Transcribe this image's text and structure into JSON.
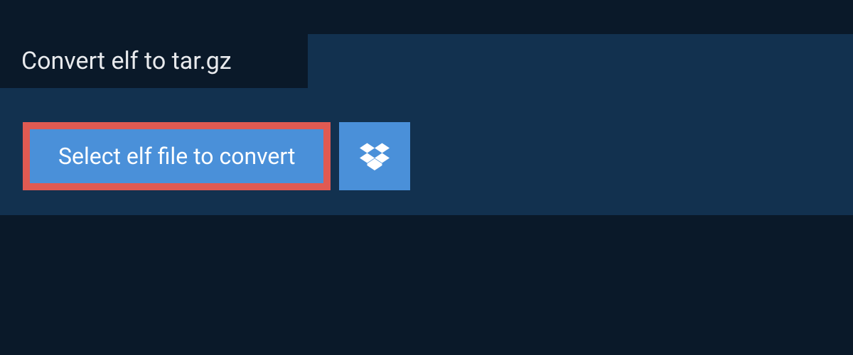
{
  "header": {
    "title": "Convert elf to tar.gz"
  },
  "actions": {
    "select_label": "Select elf file to convert"
  },
  "colors": {
    "page_bg": "#0a1929",
    "panel_bg": "#12314f",
    "button_bg": "#4a90d9",
    "highlight_border": "#e05a52"
  }
}
